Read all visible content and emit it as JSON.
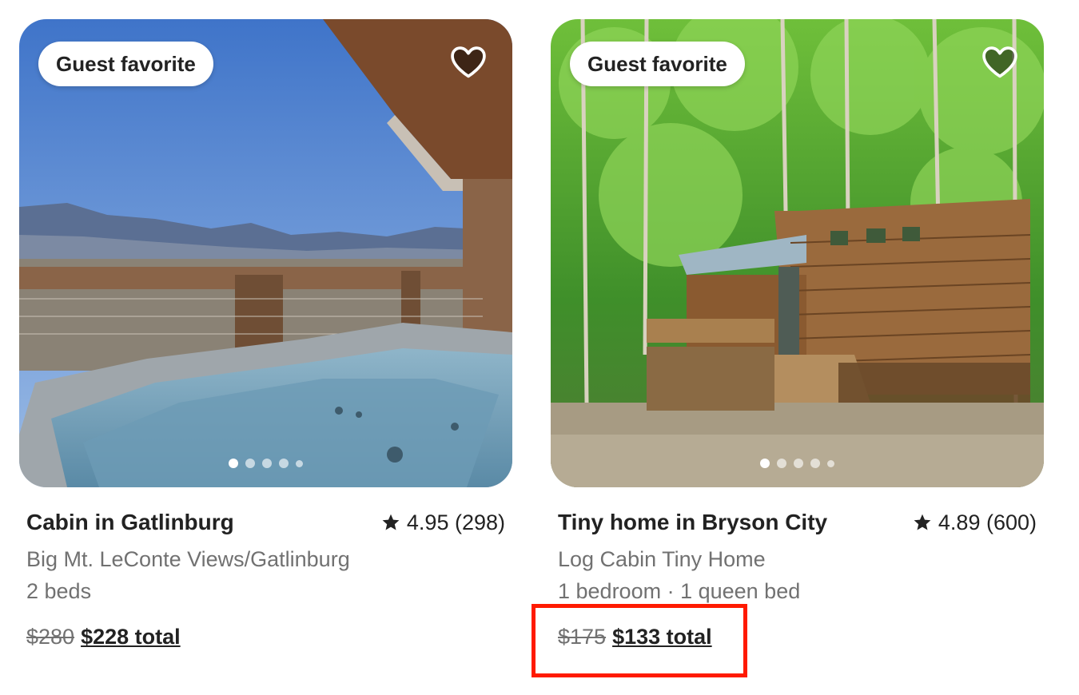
{
  "listings": [
    {
      "badge": "Guest favorite",
      "title": "Cabin in Gatlinburg",
      "rating": "4.95 (298)",
      "subtitle": "Big Mt. LeConte Views/Gatlinburg",
      "detail": "2 beds",
      "old_price": "$280",
      "new_price": "$228 total",
      "photo_count": 5,
      "active_photo": 1,
      "icons": [
        "heart-icon",
        "star-icon"
      ]
    },
    {
      "badge": "Guest favorite",
      "title": "Tiny home in Bryson City",
      "rating": "4.89 (600)",
      "subtitle": "Log Cabin Tiny Home",
      "detail": "1 bedroom · 1 queen bed",
      "old_price": "$175",
      "new_price": "$133 total",
      "photo_count": 5,
      "active_photo": 1,
      "icons": [
        "heart-icon",
        "star-icon"
      ]
    }
  ],
  "highlight_color": "#ff1a00"
}
